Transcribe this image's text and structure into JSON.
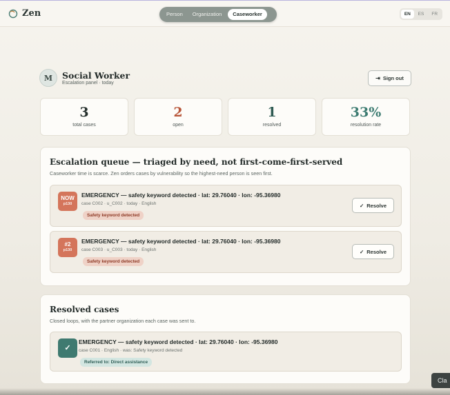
{
  "app": {
    "brand": "Zen"
  },
  "modes": [
    "Person",
    "Organization",
    "Caseworker"
  ],
  "languages": [
    "EN",
    "ES",
    "FR"
  ],
  "profile": {
    "initial": "M",
    "title": "Social Worker",
    "subtitle": "Escalation panel · today",
    "signout": "Sign out"
  },
  "stats": [
    {
      "value": "3",
      "label": "total cases",
      "color": "#26302d"
    },
    {
      "value": "2",
      "label": "open",
      "color": "#b8563a"
    },
    {
      "value": "1",
      "label": "resolved",
      "color": "#2f5b53"
    },
    {
      "value": "33%",
      "label": "resolution rate",
      "color": "#3c7b71"
    }
  ],
  "queue": {
    "title": "Escalation queue — triaged by need, not first-come-first-served",
    "description": "Caseworker time is scarce. Zen orders cases by vulnerability so the highest-need person is seen first.",
    "items": [
      {
        "rank": "NOW",
        "priority": "p130",
        "title": "EMERGENCY — safety keyword detected · lat: 29.76040 · lon: -95.36980",
        "meta": "case C002 · u_C002 · today · English",
        "tag": "Safety keyword detected",
        "action": "Resolve"
      },
      {
        "rank": "#2",
        "priority": "p130",
        "title": "EMERGENCY — safety keyword detected · lat: 29.76040 · lon: -95.36980",
        "meta": "case C003 · u_C003 · today · English",
        "tag": "Safety keyword detected",
        "action": "Resolve"
      }
    ]
  },
  "resolved": {
    "title": "Resolved cases",
    "description": "Closed loops, with the partner organization each case was sent to.",
    "items": [
      {
        "title": "EMERGENCY — safety keyword detected · lat: 29.76040 · lon: -95.36980",
        "meta": "case C001 · English · was: Safety keyword detected",
        "tag": "Referred to: Direct assistance"
      }
    ]
  },
  "tooltip": "Cla"
}
